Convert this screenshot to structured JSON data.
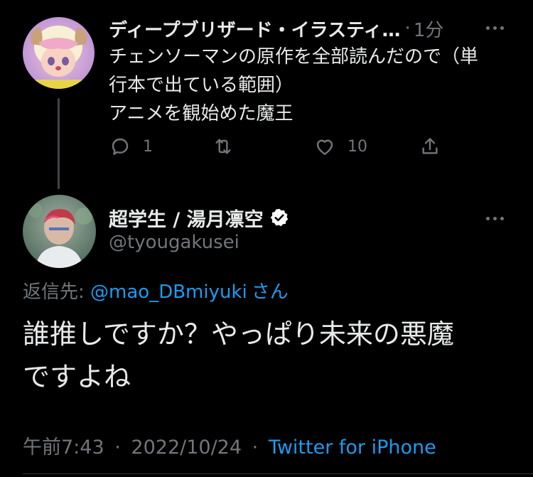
{
  "parent_tweet": {
    "display_name": "ディープブリザード・イラスティ…",
    "timestamp": "1分",
    "text": "チェンソーマンの原作を全部読んだので（単\n行本で出ている範囲）\nアニメを観始めた魔王",
    "reply_count": "1",
    "like_count": "10",
    "avatar": "anime-character-avatar"
  },
  "reply_tweet": {
    "display_name": "超学生 / 湯月凛空",
    "handle": "@tyougakusei",
    "verified": true,
    "replying_to_prefix": "返信先: ",
    "replying_to_handle": "@mao_DBmiyuki",
    "replying_to_suffix": "さん",
    "text": "誰推しですか？やっぱり未来の悪魔\nですよね",
    "time": "午前7:43",
    "date": "2022/10/24",
    "source": "Twitter for iPhone",
    "avatar": "photo-avatar"
  },
  "separator": "·",
  "colors": {
    "background": "#000000",
    "primary_text": "#e7e9ea",
    "secondary_text": "#71767b",
    "link": "#1d9bf0",
    "verified_badge": "#ffffff"
  }
}
